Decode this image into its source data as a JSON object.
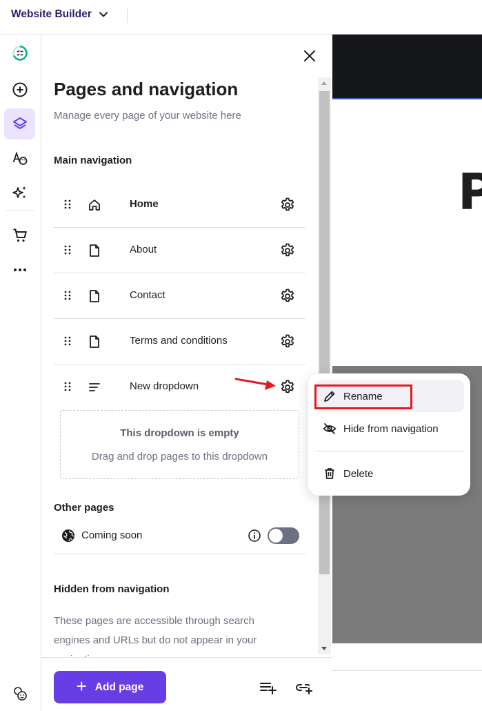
{
  "app": {
    "title": "Website Builder"
  },
  "rail": {
    "items": [
      {
        "name": "checklist-icon"
      },
      {
        "name": "add-element-icon"
      },
      {
        "name": "layers-icon",
        "active": true
      },
      {
        "name": "styles-icon"
      },
      {
        "name": "ai-tools-icon"
      },
      {
        "name": "store-cart-icon"
      },
      {
        "name": "more-icon"
      }
    ],
    "bottom_icon": "cookie-icon"
  },
  "panel": {
    "title": "Pages and navigation",
    "subtitle": "Manage every page of your website here",
    "main_nav_heading": "Main navigation",
    "main_nav": [
      {
        "label": "Home",
        "icon": "home-icon",
        "bold": true
      },
      {
        "label": "About",
        "icon": "page-icon"
      },
      {
        "label": "Contact",
        "icon": "page-icon"
      },
      {
        "label": "Terms and conditions",
        "icon": "page-icon"
      },
      {
        "label": "New dropdown",
        "icon": "dropdown-lines-icon"
      }
    ],
    "dropdown_empty": {
      "title": "This dropdown is empty",
      "hint": "Drag and drop pages to this dropdown"
    },
    "other_pages_heading": "Other pages",
    "other_pages": [
      {
        "label": "Coming soon",
        "toggle_on": false
      }
    ],
    "hidden_heading": "Hidden from navigation",
    "hidden_description": "These pages are accessible through search engines and URLs but do not appear in your navigation",
    "add_page_label": "Add page"
  },
  "context_menu": {
    "items": [
      {
        "label": "Rename",
        "icon": "pencil-icon",
        "highlighted": true
      },
      {
        "label": "Hide from navigation",
        "icon": "eye-off-icon"
      },
      {
        "label": "Delete",
        "icon": "trash-icon"
      }
    ]
  },
  "preview": {
    "heading_fragment": "P"
  },
  "colors": {
    "accent": "#673de6",
    "active_rail_bg": "#ebe4ff",
    "highlight": "#e01b24",
    "toggle_off": "#6d7081"
  }
}
